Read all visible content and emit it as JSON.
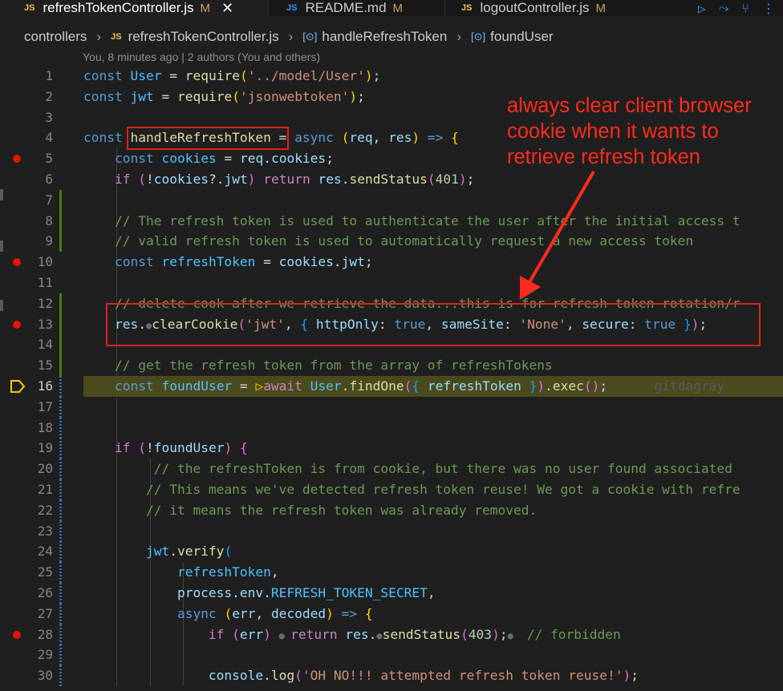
{
  "tabs": [
    {
      "icon": "JS",
      "name": "refreshTokenController.js",
      "status": "M",
      "close": "✕",
      "active": true
    },
    {
      "icon": "JS",
      "name": "README.md",
      "status": "M",
      "active": false
    },
    {
      "icon": "JS",
      "name": "logoutController.js",
      "status": "M",
      "active": false
    }
  ],
  "toolbar_icons": [
    "run-icon",
    "debug-step-icon",
    "git-branch-icon",
    "more-icon"
  ],
  "breadcrumb": {
    "folder": "controllers",
    "file": "refreshTokenController.js",
    "symbol1": "handleRefreshToken",
    "symbol2": "foundUser",
    "file_icon": "JS",
    "symbol_icon": "[⊙]"
  },
  "blame": "You, 8 minutes ago | 2 authors (You and others)",
  "gutter": {
    "current_line": 16,
    "breakpoint_lines": [
      5,
      10,
      13,
      28
    ],
    "added_lines": [
      7,
      8,
      9,
      12,
      13,
      14,
      15
    ],
    "modified_lines": [
      16,
      17,
      18,
      19,
      20,
      21,
      22,
      23,
      24,
      25,
      26,
      27,
      28,
      29,
      30
    ]
  },
  "lines": [
    {
      "n": "1",
      "t": [
        [
          "const ",
          "k"
        ],
        [
          "User",
          "cn"
        ],
        [
          " = ",
          ""
        ],
        [
          "require",
          "f"
        ],
        [
          "(",
          "p1"
        ],
        [
          "'../model/User'",
          "s"
        ],
        [
          ")",
          "p1"
        ],
        [
          ";",
          ""
        ]
      ]
    },
    {
      "n": "2",
      "t": [
        [
          "const ",
          "k"
        ],
        [
          "jwt",
          "cn"
        ],
        [
          " = ",
          ""
        ],
        [
          "require",
          "f"
        ],
        [
          "(",
          "p1"
        ],
        [
          "'jsonwebtoken'",
          "s"
        ],
        [
          ")",
          "p1"
        ],
        [
          ";",
          ""
        ]
      ]
    },
    {
      "n": "3",
      "t": []
    },
    {
      "n": "4",
      "t": [
        [
          "const ",
          "k"
        ],
        [
          "handleRefreshToken",
          "f"
        ],
        [
          " = ",
          ""
        ],
        [
          "async ",
          "k"
        ],
        [
          "(",
          "p1"
        ],
        [
          "req",
          "v"
        ],
        [
          ", ",
          ""
        ],
        [
          "res",
          "v"
        ],
        [
          ")",
          "p1"
        ],
        [
          " => ",
          "k"
        ],
        [
          "{",
          "p1"
        ]
      ]
    },
    {
      "n": "5",
      "t": [
        [
          "    const ",
          "k"
        ],
        [
          "cookies",
          "cn"
        ],
        [
          " = ",
          ""
        ],
        [
          "req",
          "v"
        ],
        [
          ".",
          ""
        ],
        [
          "cookies",
          "v"
        ],
        [
          ";",
          ""
        ]
      ]
    },
    {
      "n": "6",
      "t": [
        [
          "    if ",
          "c2"
        ],
        [
          "(",
          "p2"
        ],
        [
          "!",
          ""
        ],
        [
          "cookies",
          "v"
        ],
        [
          "?.",
          ""
        ],
        [
          "jwt",
          "v"
        ],
        [
          ") ",
          "p2"
        ],
        [
          "return ",
          "c2"
        ],
        [
          "res",
          "v"
        ],
        [
          ".",
          ""
        ],
        [
          "sendStatus",
          "f"
        ],
        [
          "(",
          "p2"
        ],
        [
          "401",
          "n"
        ],
        [
          ")",
          "p2"
        ],
        [
          ";",
          ""
        ]
      ]
    },
    {
      "n": "7",
      "t": []
    },
    {
      "n": "8",
      "t": [
        [
          "    // The refresh token is used to authenticate the user after the initial access t",
          "cm"
        ]
      ]
    },
    {
      "n": "9",
      "t": [
        [
          "    // valid refresh token is used to automatically request a new access token",
          "cm"
        ]
      ]
    },
    {
      "n": "10",
      "t": [
        [
          "    const ",
          "k"
        ],
        [
          "refreshToken",
          "cn"
        ],
        [
          " = ",
          ""
        ],
        [
          "cookies",
          "v"
        ],
        [
          ".",
          ""
        ],
        [
          "jwt",
          "v"
        ],
        [
          ";",
          ""
        ]
      ]
    },
    {
      "n": "11",
      "t": []
    },
    {
      "n": "12",
      "t": [
        [
          "    // delete cook after we retrieve the data...this is for refresh token rotation/r",
          "cm"
        ]
      ]
    },
    {
      "n": "13",
      "t": [
        [
          "    res",
          "v"
        ],
        [
          ".",
          ""
        ],
        [
          "●",
          "dot"
        ],
        [
          "clearCookie",
          "f"
        ],
        [
          "(",
          "p2"
        ],
        [
          "'jwt'",
          "s"
        ],
        [
          ", ",
          ""
        ],
        [
          "{ ",
          "p3"
        ],
        [
          "httpOnly",
          "v"
        ],
        [
          ": ",
          ""
        ],
        [
          "true",
          "k"
        ],
        [
          ", ",
          ""
        ],
        [
          "sameSite",
          "v"
        ],
        [
          ": ",
          ""
        ],
        [
          "'None'",
          "s"
        ],
        [
          ", ",
          ""
        ],
        [
          "secure",
          "v"
        ],
        [
          ": ",
          ""
        ],
        [
          "true",
          "k"
        ],
        [
          " }",
          "p3"
        ],
        [
          ")",
          "p2"
        ],
        [
          ";",
          ""
        ]
      ]
    },
    {
      "n": "14",
      "t": []
    },
    {
      "n": "15",
      "t": [
        [
          "    // get the refresh token from the array of refreshTokens",
          "cm"
        ]
      ]
    },
    {
      "n": "16",
      "t": [
        [
          "    const ",
          "k"
        ],
        [
          "foundUser",
          "cn"
        ],
        [
          " = ",
          ""
        ],
        [
          "▷",
          "p1"
        ],
        [
          "await ",
          "c2"
        ],
        [
          "User",
          "cn"
        ],
        [
          ".",
          ""
        ],
        [
          "findOne",
          "f"
        ],
        [
          "(",
          "p2"
        ],
        [
          "{ ",
          "p3"
        ],
        [
          "refreshToken",
          "v"
        ],
        [
          " }",
          "p3"
        ],
        [
          ")",
          "p2"
        ],
        [
          ".",
          ""
        ],
        [
          "exec",
          "f"
        ],
        [
          "()",
          "p2"
        ],
        [
          ";",
          ""
        ],
        [
          "      gitdagray",
          "ghost"
        ]
      ]
    },
    {
      "n": "17",
      "t": []
    },
    {
      "n": "18",
      "t": []
    },
    {
      "n": "19",
      "t": [
        [
          "    if ",
          "c2"
        ],
        [
          "(",
          "p2"
        ],
        [
          "!",
          ""
        ],
        [
          "foundUser",
          "v"
        ],
        [
          ") ",
          "p2"
        ],
        [
          "{",
          "p2"
        ]
      ]
    },
    {
      "n": "20",
      "t": [
        [
          "         // the refreshToken is from cookie, but there was no user found associated ",
          "cm"
        ]
      ]
    },
    {
      "n": "21",
      "t": [
        [
          "        // This means we've detected refresh token reuse! We got a cookie with refre",
          "cm"
        ]
      ]
    },
    {
      "n": "22",
      "t": [
        [
          "        // it means the refresh token was already removed.",
          "cm"
        ]
      ]
    },
    {
      "n": "23",
      "t": []
    },
    {
      "n": "24",
      "t": [
        [
          "        jwt",
          "cn"
        ],
        [
          ".",
          ""
        ],
        [
          "verify",
          "f"
        ],
        [
          "(",
          "p3"
        ]
      ]
    },
    {
      "n": "25",
      "t": [
        [
          "            refreshToken",
          "cn"
        ],
        [
          ",",
          ""
        ]
      ]
    },
    {
      "n": "26",
      "t": [
        [
          "            process",
          "v"
        ],
        [
          ".",
          ""
        ],
        [
          "env",
          "v"
        ],
        [
          ".",
          ""
        ],
        [
          "REFRESH_TOKEN_SECRET",
          "cn"
        ],
        [
          ",",
          ""
        ]
      ]
    },
    {
      "n": "27",
      "t": [
        [
          "            async ",
          "k"
        ],
        [
          "(",
          "p1"
        ],
        [
          "err",
          "v"
        ],
        [
          ", ",
          ""
        ],
        [
          "decoded",
          "v"
        ],
        [
          ")",
          "p1"
        ],
        [
          " => ",
          "k"
        ],
        [
          "{",
          "p1"
        ]
      ]
    },
    {
      "n": "28",
      "t": [
        [
          "                if ",
          "c2"
        ],
        [
          "(",
          "p2"
        ],
        [
          "err",
          "v"
        ],
        [
          ") ",
          "p2"
        ],
        [
          "● ",
          "dot"
        ],
        [
          "return ",
          "c2"
        ],
        [
          "res",
          "v"
        ],
        [
          ".",
          ""
        ],
        [
          "●",
          "dot"
        ],
        [
          "sendStatus",
          "f"
        ],
        [
          "(",
          "p2"
        ],
        [
          "403",
          "n"
        ],
        [
          ")",
          "p2"
        ],
        [
          ";",
          ""
        ],
        [
          "● ",
          "dot"
        ],
        [
          " // forbidden",
          "cm"
        ]
      ]
    },
    {
      "n": "29",
      "t": []
    },
    {
      "n": "30",
      "t": [
        [
          "                console",
          "v"
        ],
        [
          ".",
          ""
        ],
        [
          "log",
          "f"
        ],
        [
          "(",
          "p2"
        ],
        [
          "'OH NO!!! attempted refresh token reuse!'",
          "s"
        ],
        [
          ")",
          "p2"
        ],
        [
          ";",
          ""
        ]
      ]
    }
  ],
  "annotation": {
    "text": "always clear client browser\ncookie when it wants to\nretrieve refresh token",
    "color": "#ff2a1c"
  }
}
